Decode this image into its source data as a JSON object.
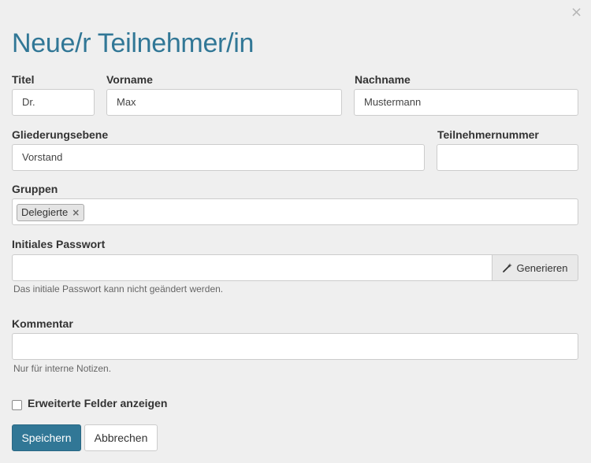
{
  "dialog": {
    "title": "Neue/r Teilnehmer/in",
    "close_glyph": "×"
  },
  "fields": {
    "titel": {
      "label": "Titel",
      "value": "Dr."
    },
    "vorname": {
      "label": "Vorname",
      "value": "Max"
    },
    "nachname": {
      "label": "Nachname",
      "value": "Mustermann"
    },
    "gliederung": {
      "label": "Gliederungsebene",
      "value": "Vorstand"
    },
    "teilnehmernummer": {
      "label": "Teilnehmernummer",
      "value": ""
    },
    "gruppen": {
      "label": "Gruppen",
      "chips": [
        {
          "label": "Delegierte",
          "remove": "×"
        }
      ]
    },
    "passwort": {
      "label": "Initiales Passwort",
      "value": "",
      "generate_label": "Generieren",
      "help": "Das initiale Passwort kann nicht geändert werden."
    },
    "kommentar": {
      "label": "Kommentar",
      "value": "",
      "help": "Nur für interne Notizen."
    }
  },
  "extended": {
    "label": "Erweiterte Felder anzeigen",
    "checked": false
  },
  "actions": {
    "save": "Speichern",
    "cancel": "Abbrechen"
  },
  "colors": {
    "primary": "#317796",
    "background": "#efefef"
  }
}
